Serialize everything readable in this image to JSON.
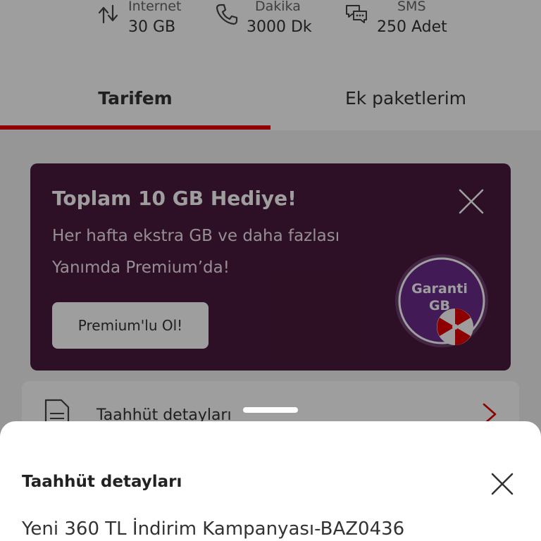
{
  "usage": {
    "internet": {
      "label": "Internet",
      "value": "30 GB",
      "icon": "data-transfer-icon"
    },
    "minutes": {
      "label": "Dakika",
      "value": "3000 Dk",
      "icon": "phone-icon"
    },
    "sms": {
      "label": "SMS",
      "value": "250 Adet",
      "icon": "chat-bubbles-icon"
    }
  },
  "tabs": [
    {
      "label": "Tarifem",
      "active": true
    },
    {
      "label": "Ek paketlerim",
      "active": false
    }
  ],
  "promo": {
    "title": "Toplam 10 GB Hediye!",
    "line1": "Her hafta ekstra GB ve daha fazlası",
    "line2": "Yanımda Premium’da!",
    "button": "Premium'lu Ol!",
    "badge_line1": "Garanti",
    "badge_line2": "GB"
  },
  "commitment_row": {
    "label": "Taahhüt detayları"
  },
  "sheet": {
    "title": "Taahhüt detayları",
    "body": "Yeni 360 TL İndirim Kampanyası-BAZ0436"
  },
  "colors": {
    "accent": "#e60000",
    "promo_bg": "#4a1a3c",
    "badge_bg": "#6a2a8c"
  }
}
